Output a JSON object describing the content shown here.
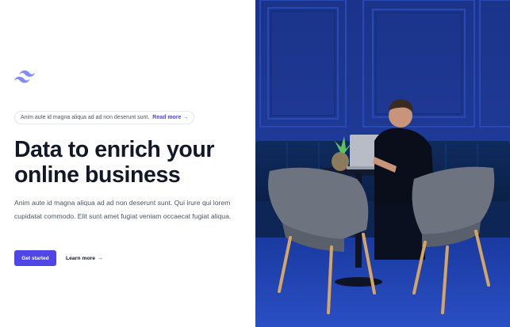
{
  "brand": {
    "logo_icon": "tailwind-logo-icon",
    "accent": "#4f46e5",
    "accent_light": "#818cf8"
  },
  "announcement": {
    "text": "Anim aute id magna aliqua ad ad non deserunt sunt.",
    "link_label": "Read more",
    "link_arrow": "→"
  },
  "hero": {
    "title_line1": "Data to enrich your",
    "title_line2": "online business",
    "description": "Anim aute id magna aliqua ad ad non deserunt sunt. Qui irure qui lorem cupidatat commodo. Elit sunt amet fugiat veniam occaecat fugiat aliqua."
  },
  "actions": {
    "primary_label": "Get started",
    "secondary_label": "Learn more",
    "secondary_arrow": "→"
  },
  "photo": {
    "wall_color": "#1f3d9c",
    "floor_color": "#1c3fa8"
  }
}
